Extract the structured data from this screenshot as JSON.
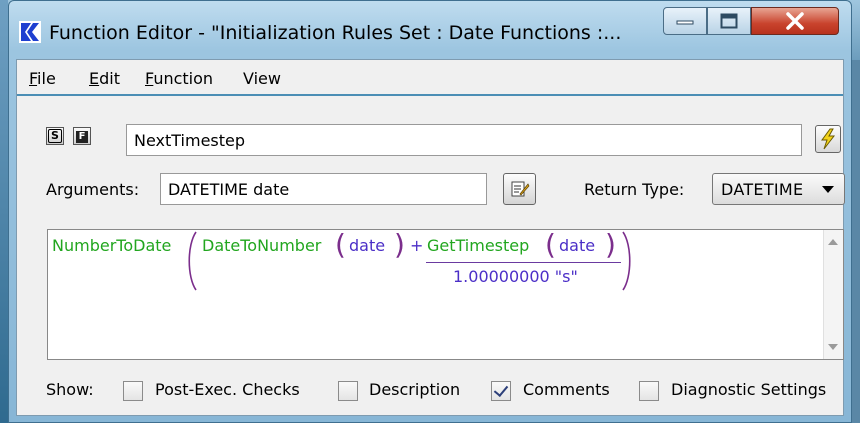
{
  "window": {
    "title": "Function Editor - \"Initialization Rules Set : Date Functions :...",
    "colors": {
      "close": "#c9432d",
      "app_icon_blue": "#1e3fd0",
      "bolt": "#f2d21a"
    }
  },
  "menubar": {
    "items": [
      {
        "label": "File",
        "mnemonic": "F",
        "rest": "ile"
      },
      {
        "label": "Edit",
        "mnemonic": "E",
        "rest": "dit"
      },
      {
        "label": "Function",
        "mnemonic": "F",
        "rest": "unction"
      },
      {
        "label": "View",
        "mnemonic": "",
        "rest": "View"
      }
    ]
  },
  "toolbar": {
    "s_button": "S",
    "f_button": "F",
    "function_name": "NextTimestep",
    "execute_icon": "lightning-bolt-icon"
  },
  "arguments": {
    "label": "Arguments:",
    "value": "DATETIME date",
    "edit_icon": "edit-note-icon"
  },
  "return_type": {
    "label": "Return Type:",
    "selected": "DATETIME"
  },
  "expression": {
    "outer_func": "NumberToDate",
    "inner_func": "DateToNumber",
    "arg1": "date",
    "plus": "+",
    "ts_func": "GetTimestep",
    "arg2": "date",
    "denominator": "1.00000000 \"s\"",
    "colors": {
      "function": "#22a61f",
      "argument": "#4b2fc7",
      "paren": "#7b2e8c"
    }
  },
  "show": {
    "label": "Show:",
    "options": [
      {
        "label": "Post-Exec. Checks",
        "checked": false
      },
      {
        "label": "Description",
        "checked": false
      },
      {
        "label": "Comments",
        "checked": true
      },
      {
        "label": "Diagnostic Settings",
        "checked": false
      }
    ]
  }
}
